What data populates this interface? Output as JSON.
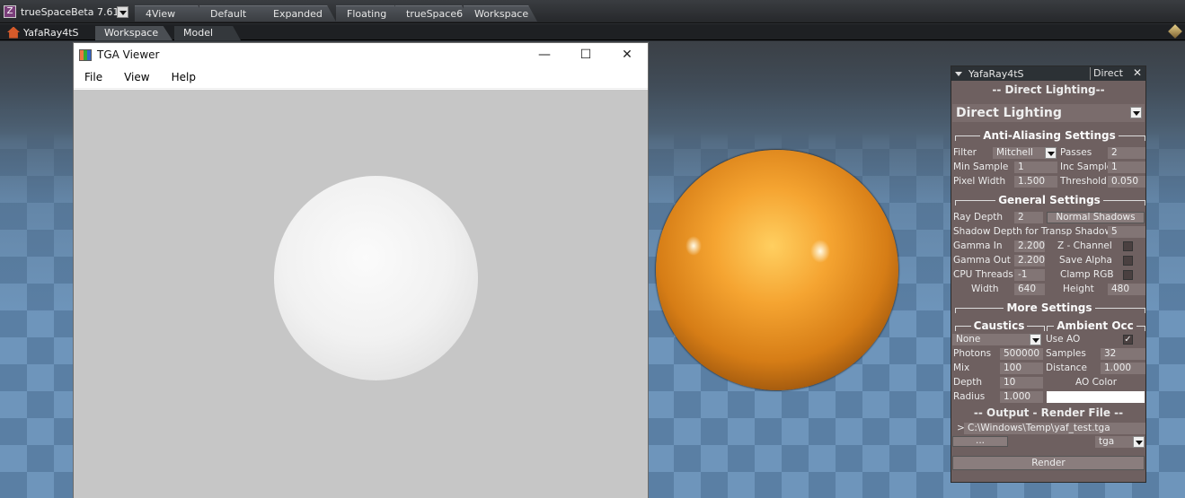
{
  "app": {
    "title": "trueSpaceBeta 7.61"
  },
  "workspace_tabs": [
    "4View",
    "Default",
    "Expanded",
    "Floating",
    "trueSpace6",
    "Workspace"
  ],
  "secondbar": {
    "plugin": "YafaRay4tS",
    "tabs": [
      "Workspace",
      "Model"
    ]
  },
  "tga_viewer": {
    "title": "TGA Viewer",
    "menu": [
      "File",
      "View",
      "Help"
    ],
    "min": "—",
    "max": "☐",
    "close": "✕"
  },
  "panel": {
    "title": "YafaRay4tS",
    "mode": "Direct",
    "close": "✕",
    "header": "-- Direct Lighting--",
    "method": "Direct Lighting",
    "aa": {
      "section": "Anti-Aliasing Settings",
      "filter_label": "Filter",
      "filter": "Mitchell",
      "passes_label": "Passes",
      "passes": "2",
      "min_sample_label": "Min Sample",
      "min_sample": "1",
      "inc_sample_label": "Inc Sample",
      "inc_sample": "1",
      "pixel_width_label": "Pixel Width",
      "pixel_width": "1.500",
      "threshold_label": "Threshold",
      "threshold": "0.050"
    },
    "general": {
      "section": "General Settings",
      "ray_depth_label": "Ray Depth",
      "ray_depth": "2",
      "shadows_button": "Normal Shadows",
      "shadow_depth_label": "Shadow Depth for Transp Shadows",
      "shadow_depth": "5",
      "gamma_in_label": "Gamma In",
      "gamma_in": "2.200",
      "zchannel_label": "Z - Channel",
      "gamma_out_label": "Gamma Out",
      "gamma_out": "2.200",
      "save_alpha_label": "Save Alpha",
      "cpu_label": "CPU Threads",
      "cpu": "-1",
      "clamp_label": "Clamp RGB",
      "width_label": "Width",
      "width": "640",
      "height_label": "Height",
      "height": "480"
    },
    "more": {
      "section": "More Settings",
      "caustics": "Caustics",
      "ambient": "Ambient Occ",
      "caustics_mode": "None",
      "use_ao_label": "Use AO",
      "use_ao_check": "✓",
      "photons_label": "Photons",
      "photons": "500000",
      "samples_label": "Samples",
      "samples": "32",
      "mix_label": "Mix",
      "mix": "100",
      "distance_label": "Distance",
      "distance": "1.000",
      "depth_label": "Depth",
      "depth": "10",
      "ao_color_label": "AO Color",
      "radius_label": "Radius",
      "radius": "1.000"
    },
    "output": {
      "section": "-- Output - Render File --",
      "prompt": ">",
      "path": "C:\\Windows\\Temp\\yaf_test.tga",
      "browse": "...",
      "format": "tga",
      "render": "Render"
    }
  },
  "colors": {
    "orange_sphere": "#f5a431",
    "panel_bg": "#6e6060",
    "floor_light": "#6e95bb"
  }
}
